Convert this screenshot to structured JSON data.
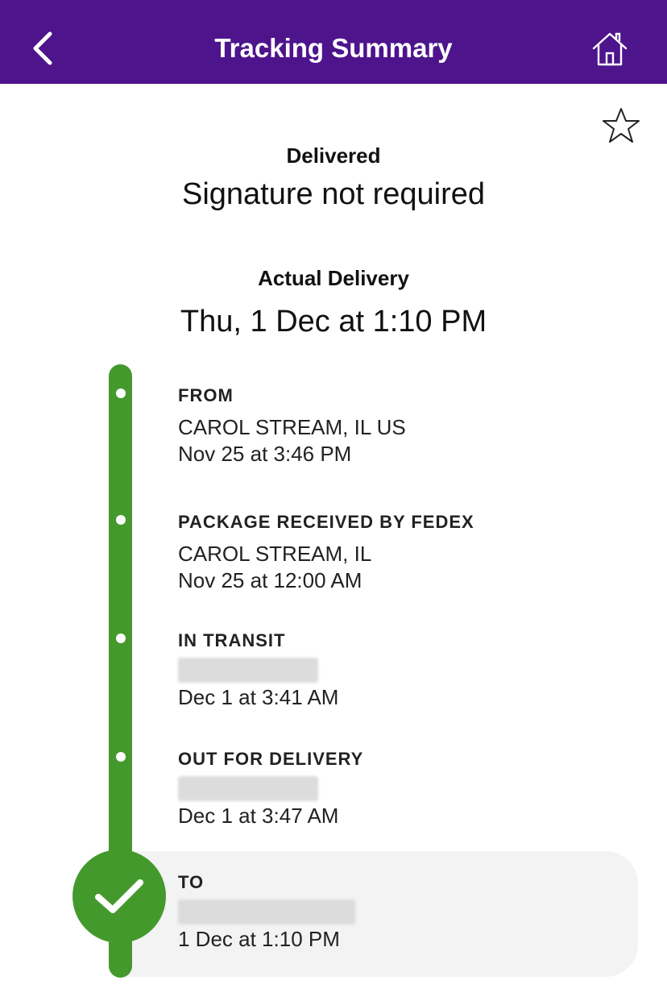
{
  "header": {
    "title": "Tracking Summary",
    "back_icon": "chevron-left-icon",
    "home_icon": "home-icon"
  },
  "favorite_icon": "star-outline-icon",
  "status": {
    "label": "Delivered",
    "subtitle": "Signature not required"
  },
  "delivery": {
    "label": "Actual Delivery",
    "date": "Thu, 1 Dec at 1:10 PM"
  },
  "timeline": {
    "events": [
      {
        "title": "FROM",
        "location": "CAROL STREAM, IL US",
        "time": "Nov 25 at 3:46 PM"
      },
      {
        "title": "PACKAGE RECEIVED BY FEDEX",
        "location": "CAROL STREAM, IL",
        "time": "Nov 25 at 12:00 AM"
      },
      {
        "title": "IN TRANSIT",
        "location": "",
        "time": "Dec 1 at 3:41 AM"
      },
      {
        "title": "OUT FOR DELIVERY",
        "location": "",
        "time": "Dec 1 at 3:47 AM"
      },
      {
        "title": "TO",
        "location": "",
        "time": "1 Dec at 1:10 PM"
      }
    ]
  },
  "colors": {
    "header_bg": "#4d148c",
    "timeline_green": "#44992d",
    "card_bg": "#f3f3f3"
  }
}
